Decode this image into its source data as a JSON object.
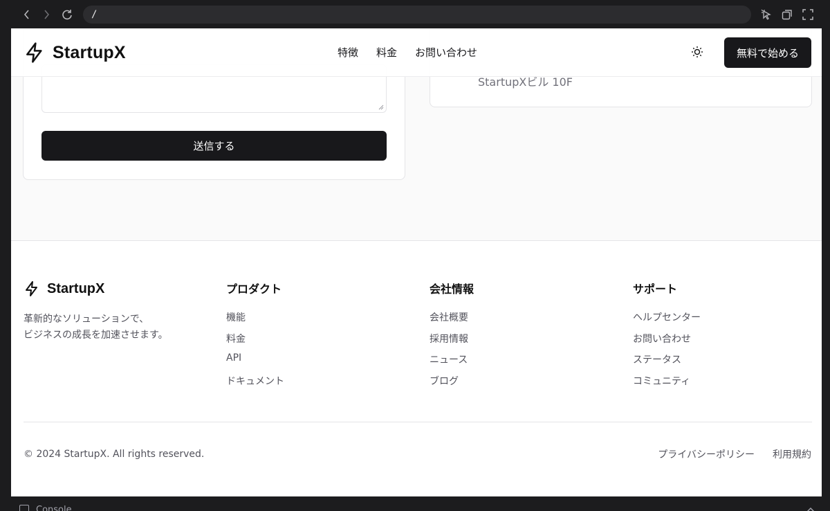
{
  "browser": {
    "url": "/"
  },
  "header": {
    "brand": "StartupX",
    "nav": [
      "特徴",
      "料金",
      "お問い合わせ"
    ],
    "cta_label": "無料で始める"
  },
  "contact": {
    "submit_label": "送信する",
    "address_line": "StartupXビル 10F"
  },
  "footer": {
    "brand": "StartupX",
    "tagline_line1": "革新的なソリューションで、",
    "tagline_line2": "ビジネスの成長を加速させます。",
    "columns": [
      {
        "title": "プロダクト",
        "items": [
          "機能",
          "料金",
          "API",
          "ドキュメント"
        ]
      },
      {
        "title": "会社情報",
        "items": [
          "会社概要",
          "採用情報",
          "ニュース",
          "ブログ"
        ]
      },
      {
        "title": "サポート",
        "items": [
          "ヘルプセンター",
          "お問い合わせ",
          "ステータス",
          "コミュニティ"
        ]
      }
    ],
    "copyright": "© 2024 StartupX. All rights reserved.",
    "legal": [
      "プライバシーポリシー",
      "利用規約"
    ]
  },
  "devtools": {
    "console_label": "Console"
  },
  "colors": {
    "primary": "#18181b",
    "muted_text": "#52525b",
    "border": "#e4e4e7"
  }
}
